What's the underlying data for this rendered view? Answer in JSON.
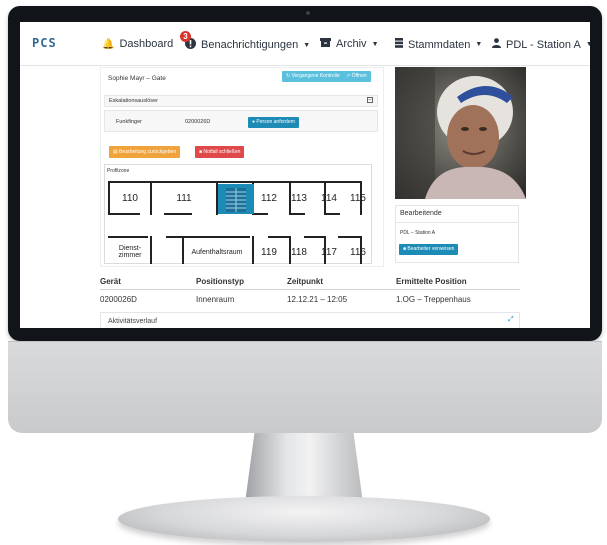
{
  "nav": {
    "logo": "PCS",
    "dashboard": "Dashboard",
    "notifications": "Benachrichtigungen",
    "notifications_badge": "3",
    "archive": "Archiv",
    "masterdata": "Stammdaten",
    "user": "PDL - Station A"
  },
  "card": {
    "title": "Sophie Mayr – Gate",
    "btn_vergangene": "Vergangene Kontrolle",
    "btn_oeffnen": "Öffnen",
    "escalation_label": "Eskalationsauslöser",
    "trigger_type": "Funkfinger",
    "trigger_device": "0200026D",
    "btn_person": "Person anfordern",
    "btn_back": "Bearbeitung zurückgeben",
    "btn_close": "Notfall schließen",
    "floorplan_label": "Profilzone"
  },
  "rooms_top": [
    "110",
    "111",
    "112",
    "113",
    "114",
    "115"
  ],
  "rooms_bottom": [
    "Dienst-\nzimmer",
    "Aufenthaltsraum",
    "119",
    "118",
    "117",
    "116"
  ],
  "editors": {
    "title": "Bearbeitende",
    "entry": "PDL – Station A",
    "btn_forward": "Bearbeiter verweisen"
  },
  "table": {
    "headers": [
      "Gerät",
      "Positionstyp",
      "Zeitpunkt",
      "Ermittelte Position"
    ],
    "row": [
      "0200026D",
      "Innenraum",
      "12.12.21 – 12:05",
      "1.OG – Treppenhaus"
    ]
  },
  "activity": {
    "title": "Aktivitätsverlauf"
  },
  "colors": {
    "accent_blue": "#1c8bb5",
    "orange": "#f0a23b",
    "red": "#e0494a",
    "light_blue": "#5bc0de"
  }
}
